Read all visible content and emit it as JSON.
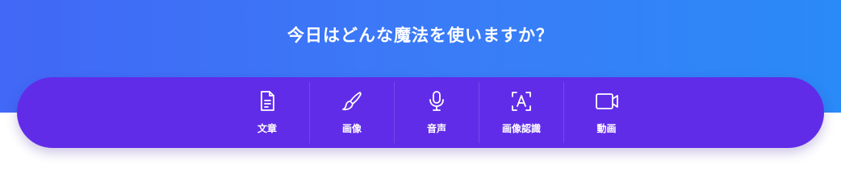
{
  "hero": {
    "title": "今日はどんな魔法を使いますか？"
  },
  "toolbar": {
    "items": [
      {
        "label": "文章",
        "icon": "document-icon"
      },
      {
        "label": "画像",
        "icon": "brush-icon"
      },
      {
        "label": "音声",
        "icon": "microphone-icon"
      },
      {
        "label": "画像認識",
        "icon": "text-recognition-icon"
      },
      {
        "label": "動画",
        "icon": "video-camera-icon"
      }
    ]
  },
  "colors": {
    "hero_gradient_start": "#4168f6",
    "hero_gradient_end": "#2a8af7",
    "toolbar_background": "#612ce8",
    "text": "#ffffff"
  }
}
